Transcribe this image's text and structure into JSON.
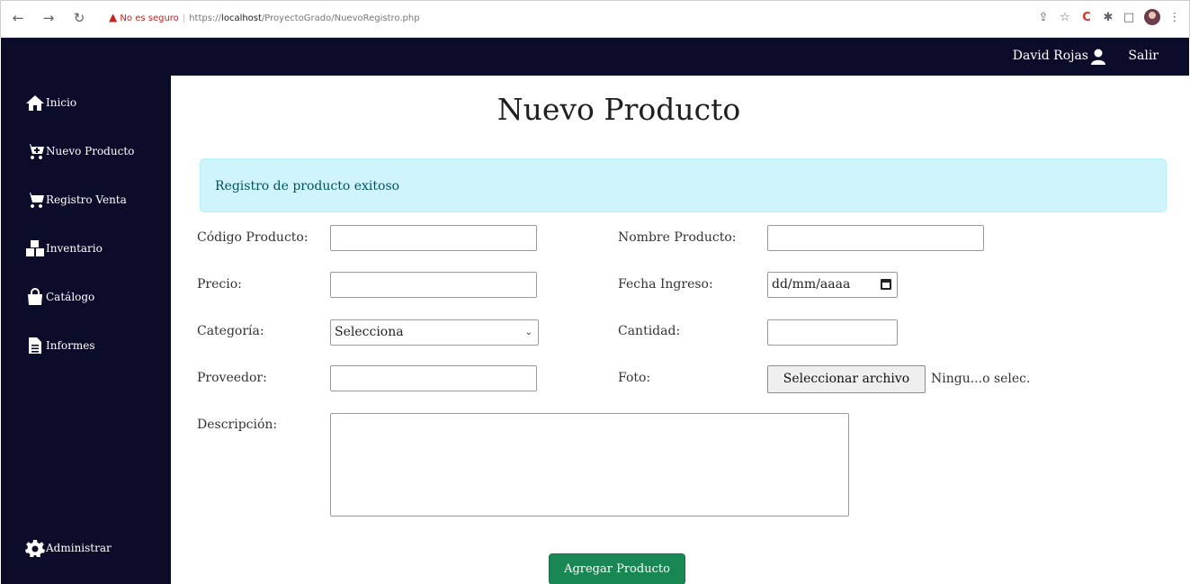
{
  "browser": {
    "back_icon": "arrow-left-icon",
    "forward_icon": "arrow-right-icon",
    "reload_icon": "reload-icon",
    "security_label": "No es seguro",
    "url_prefix": "https://",
    "url_host": "localhost",
    "url_path": "/ProyectoGrado/NuevoRegistro.php"
  },
  "topbar": {
    "user_name": "David Rojas",
    "logout_label": "Salir",
    "background_color": "#0b0c2a"
  },
  "sidebar": {
    "items": [
      {
        "label": "Inicio",
        "icon": "home-icon"
      },
      {
        "label": "Nuevo Producto",
        "icon": "cart-plus-icon"
      },
      {
        "label": "Registro Venta",
        "icon": "cart-icon"
      },
      {
        "label": "Inventario",
        "icon": "boxes-icon"
      },
      {
        "label": "Catálogo",
        "icon": "shopping-bag-icon"
      },
      {
        "label": "Informes",
        "icon": "file-icon"
      }
    ],
    "admin_label": "Administrar",
    "admin_icon": "gear-icon"
  },
  "main": {
    "title": "Nuevo Producto",
    "alert": "Registro de producto exitoso",
    "alert_color": "#cff4fc"
  },
  "form": {
    "codigo_label": "Código Producto:",
    "nombre_label": "Nombre Producto:",
    "precio_label": "Precio:",
    "fecha_label": "Fecha Ingreso:",
    "fecha_placeholder": "dd/mm/aaaa",
    "categoria_label": "Categoría:",
    "categoria_selected": "Selecciona",
    "cantidad_label": "Cantidad:",
    "proveedor_label": "Proveedor:",
    "foto_label": "Foto:",
    "file_button": "Seleccionar archivo",
    "file_name": "Ningu...o selec.",
    "descripcion_label": "Descripción:",
    "submit_label": "Agregar Producto",
    "submit_color": "#198754"
  }
}
